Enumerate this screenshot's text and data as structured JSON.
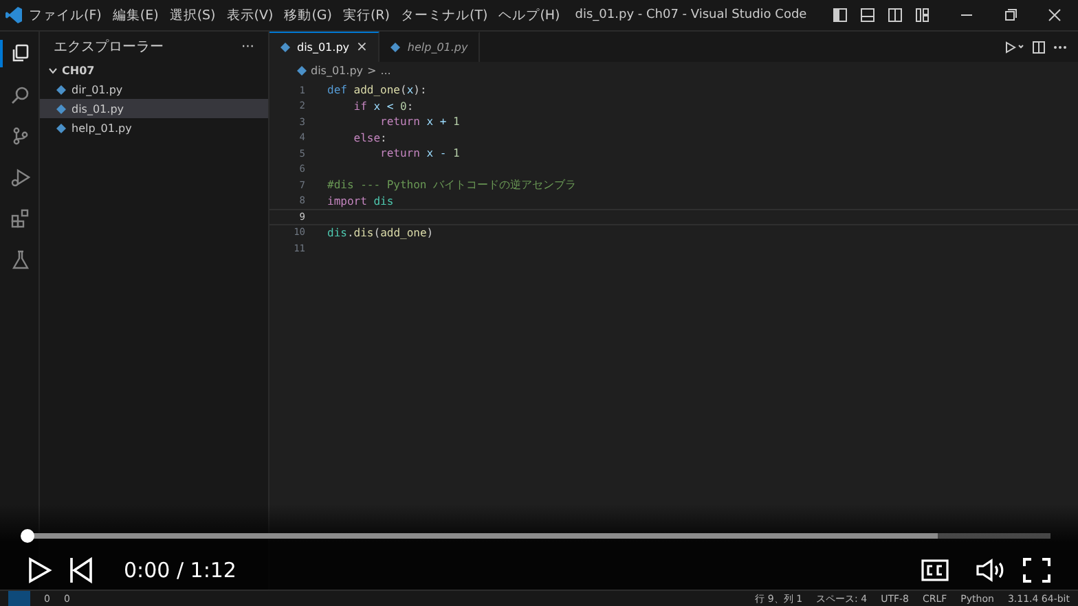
{
  "title_bar": {
    "menus": [
      "ファイル(F)",
      "編集(E)",
      "選択(S)",
      "表示(V)",
      "移動(G)",
      "実行(R)",
      "ターミナル(T)",
      "ヘルプ(H)"
    ],
    "title": "dis_01.py - Ch07 - Visual Studio Code"
  },
  "activity_bar": [
    {
      "kind": "files",
      "selected": true
    },
    {
      "kind": "search",
      "selected": false
    },
    {
      "kind": "source-control",
      "selected": false
    },
    {
      "kind": "run-debug",
      "selected": false
    },
    {
      "kind": "extensions",
      "selected": false
    },
    {
      "kind": "testing",
      "selected": false
    }
  ],
  "sidebar": {
    "title": "エクスプローラー",
    "more": "···",
    "folder": "CH07",
    "files": [
      {
        "name": "dir_01.py",
        "selected": false
      },
      {
        "name": "dis_01.py",
        "selected": true
      },
      {
        "name": "help_01.py",
        "selected": false
      }
    ]
  },
  "tabs": [
    {
      "label": "dis_01.py",
      "selected": true,
      "preview": false,
      "close": "×"
    },
    {
      "label": "help_01.py",
      "selected": false,
      "preview": true
    }
  ],
  "breadcrumb": {
    "file": "dis_01.py",
    "separator": ">",
    "rest": "..."
  },
  "editor": {
    "lines": [
      {
        "number": "1",
        "current": false,
        "tokens": [
          {
            "text": "def",
            "kind": "storage"
          },
          {
            "text": " add_one",
            "kind": "function"
          },
          {
            "text": "(",
            "kind": "plain"
          },
          {
            "text": "x",
            "kind": "param"
          },
          {
            "text": "):",
            "kind": "plain"
          }
        ]
      },
      {
        "number": "2",
        "current": false,
        "tokens": [
          {
            "text": "    if",
            "kind": "control"
          },
          {
            "text": " x < ",
            "kind": "param"
          },
          {
            "text": "0",
            "kind": "number"
          },
          {
            "text": ":",
            "kind": "plain"
          }
        ]
      },
      {
        "number": "3",
        "current": false,
        "tokens": [
          {
            "text": "        return",
            "kind": "control"
          },
          {
            "text": " x + ",
            "kind": "param"
          },
          {
            "text": "1",
            "kind": "number"
          }
        ]
      },
      {
        "number": "4",
        "current": false,
        "tokens": [
          {
            "text": "    else",
            "kind": "control"
          },
          {
            "text": ":",
            "kind": "plain"
          }
        ]
      },
      {
        "number": "5",
        "current": false,
        "tokens": [
          {
            "text": "        return",
            "kind": "control"
          },
          {
            "text": " x - ",
            "kind": "param"
          },
          {
            "text": "1",
            "kind": "number"
          }
        ]
      },
      {
        "number": "6",
        "current": false
      },
      {
        "number": "7",
        "current": false,
        "tokens": [
          {
            "text": "#dis --- Python バイトコードの逆アセンブラ",
            "kind": "comment"
          }
        ]
      },
      {
        "number": "8",
        "current": false,
        "tokens": [
          {
            "text": "import",
            "kind": "control"
          },
          {
            "text": " dis",
            "kind": "module"
          }
        ]
      },
      {
        "number": "9",
        "current": true
      },
      {
        "number": "10",
        "current": false,
        "tokens": [
          {
            "text": "dis",
            "kind": "module"
          },
          {
            "text": ".",
            "kind": "plain"
          },
          {
            "text": "dis",
            "kind": "function"
          },
          {
            "text": "(",
            "kind": "plain"
          },
          {
            "text": "add_one",
            "kind": "function"
          },
          {
            "text": ")",
            "kind": "plain"
          }
        ]
      },
      {
        "number": "11",
        "current": false
      }
    ]
  },
  "status_bar": {
    "errors": "0",
    "warnings": "0",
    "items": [
      "行 9、列 1",
      "スペース: 4",
      "UTF-8",
      "CRLF",
      "Python",
      "3.11.4 64-bit"
    ]
  },
  "player": {
    "progress": {
      "level": 0
    },
    "buffer": {
      "level": 0.89
    },
    "time": "0:00 / 1:12"
  }
}
